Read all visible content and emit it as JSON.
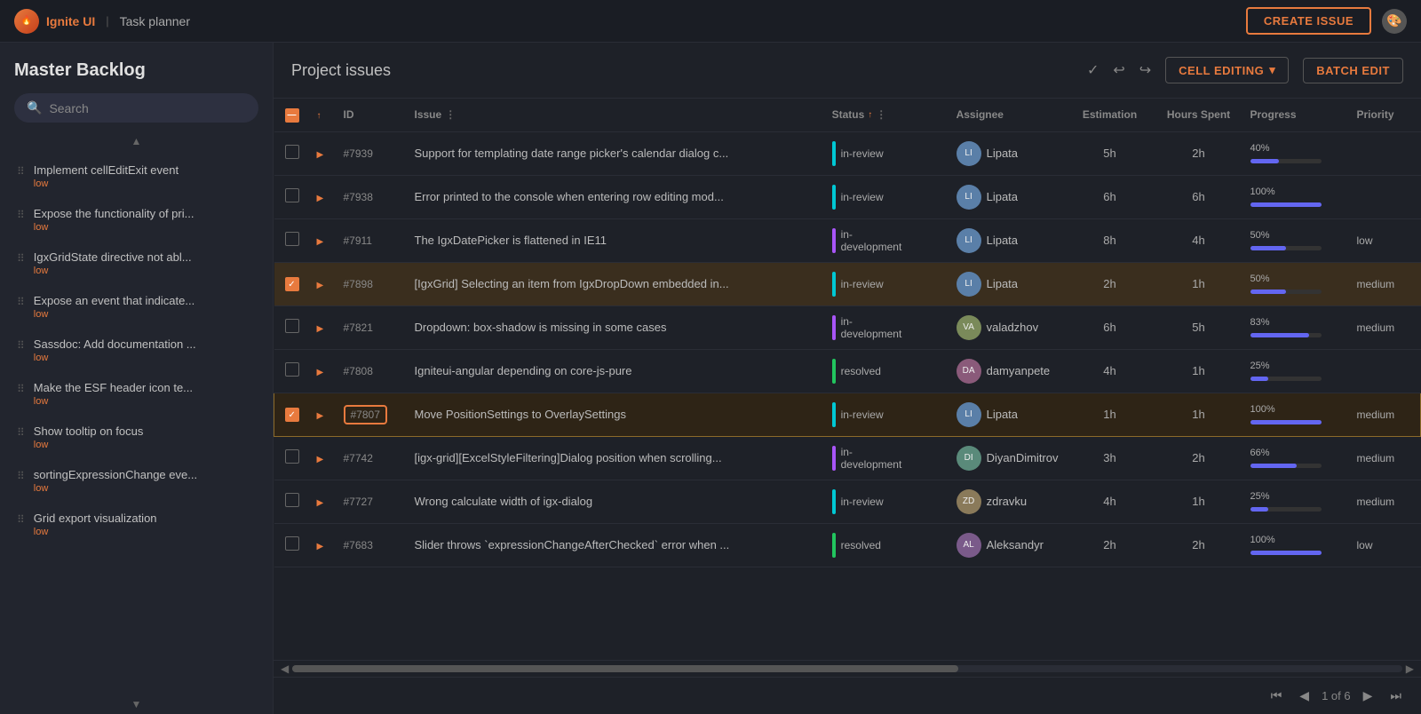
{
  "app": {
    "logo_text": "🔥",
    "brand": "Ignite UI",
    "page_title": "Task planner"
  },
  "header": {
    "create_issue_label": "CREATE ISSUE",
    "theme_icon": "🎨"
  },
  "sidebar": {
    "title": "Master Backlog",
    "search_placeholder": "Search",
    "items": [
      {
        "title": "Implement cellEditExit event",
        "sub": "low"
      },
      {
        "title": "Expose the functionality of pri...",
        "sub": "low"
      },
      {
        "title": "IgxGridState directive not abl...",
        "sub": "low"
      },
      {
        "title": "Expose an event that indicate...",
        "sub": "low"
      },
      {
        "title": "Sassdoc: Add documentation ...",
        "sub": "low"
      },
      {
        "title": "Make the ESF header icon te...",
        "sub": "low"
      },
      {
        "title": "Show tooltip on focus",
        "sub": "low"
      },
      {
        "title": "sortingExpressionChange eve...",
        "sub": "low"
      },
      {
        "title": "Grid export visualization",
        "sub": "low"
      }
    ]
  },
  "content": {
    "title": "Project issues",
    "cell_editing_label": "CELL EDITING",
    "batch_edit_label": "BATCH EDIT"
  },
  "table": {
    "columns": [
      "",
      "",
      "ID",
      "Issue",
      "Status",
      "Assignee",
      "Estimation",
      "Hours Spent",
      "Progress",
      "Priority"
    ],
    "rows": [
      {
        "id": "#7939",
        "issue": "Support for templating date range picker's calendar dialog c...",
        "status": "in-review",
        "status_label": "in-review",
        "assignee": "Lipata",
        "estimation": "5h",
        "hours_spent": "2h",
        "progress": 40,
        "progress_label": "40%",
        "priority": "",
        "checked": false,
        "selected": false
      },
      {
        "id": "#7938",
        "issue": "Error printed to the console when entering row editing mod...",
        "status": "in-review",
        "status_label": "in-review",
        "assignee": "Lipata",
        "estimation": "6h",
        "hours_spent": "6h",
        "progress": 100,
        "progress_label": "100%",
        "priority": "",
        "checked": false,
        "selected": false
      },
      {
        "id": "#7911",
        "issue": "The IgxDatePicker is flattened in IE11",
        "status": "in-development",
        "status_label": "in-\ndevelopment",
        "assignee": "Lipata",
        "estimation": "8h",
        "hours_spent": "4h",
        "progress": 50,
        "progress_label": "50%",
        "priority": "low",
        "checked": false,
        "selected": false
      },
      {
        "id": "#7898",
        "issue": "[IgxGrid] Selecting an item from IgxDropDown embedded in...",
        "status": "in-review",
        "status_label": "in-review",
        "assignee": "Lipata",
        "estimation": "2h",
        "hours_spent": "1h",
        "progress": 50,
        "progress_label": "50%",
        "priority": "medium",
        "checked": true,
        "selected": true
      },
      {
        "id": "#7821",
        "issue": "Dropdown: box-shadow is missing in some cases",
        "status": "in-development",
        "status_label": "in-\ndevelopment",
        "assignee": "valadzhov",
        "estimation": "6h",
        "hours_spent": "5h",
        "progress": 83,
        "progress_label": "83%",
        "priority": "medium",
        "checked": false,
        "selected": false
      },
      {
        "id": "#7808",
        "issue": "Igniteui-angular depending on core-js-pure",
        "status": "resolved",
        "status_label": "resolved",
        "assignee": "damyanpete",
        "estimation": "4h",
        "hours_spent": "1h",
        "progress": 25,
        "progress_label": "25%",
        "priority": "",
        "checked": false,
        "selected": false
      },
      {
        "id": "#7807",
        "issue": "Move PositionSettings to OverlaySettings",
        "status": "in-review",
        "status_label": "in-review",
        "assignee": "Lipata",
        "estimation": "1h",
        "hours_spent": "1h",
        "progress": 100,
        "progress_label": "100%",
        "priority": "medium",
        "checked": true,
        "selected": true,
        "highlighted": true
      },
      {
        "id": "#7742",
        "issue": "[igx-grid][ExcelStyleFiltering]Dialog position when scrolling...",
        "status": "in-development",
        "status_label": "in-\ndevelopment",
        "assignee": "DiyanDimitrov",
        "estimation": "3h",
        "hours_spent": "2h",
        "progress": 66,
        "progress_label": "66%",
        "priority": "medium",
        "checked": false,
        "selected": false
      },
      {
        "id": "#7727",
        "issue": "Wrong calculate width of igx-dialog",
        "status": "in-review",
        "status_label": "in-review",
        "assignee": "zdravku",
        "estimation": "4h",
        "hours_spent": "1h",
        "progress": 25,
        "progress_label": "25%",
        "priority": "medium",
        "checked": false,
        "selected": false
      },
      {
        "id": "#7683",
        "issue": "Slider throws `expressionChangeAfterChecked` error when ...",
        "status": "resolved",
        "status_label": "resolved",
        "assignee": "Aleksandyr",
        "estimation": "2h",
        "hours_spent": "2h",
        "progress": 100,
        "progress_label": "100%",
        "priority": "low",
        "checked": false,
        "selected": false
      }
    ]
  },
  "pagination": {
    "page_info": "1 of 6"
  }
}
